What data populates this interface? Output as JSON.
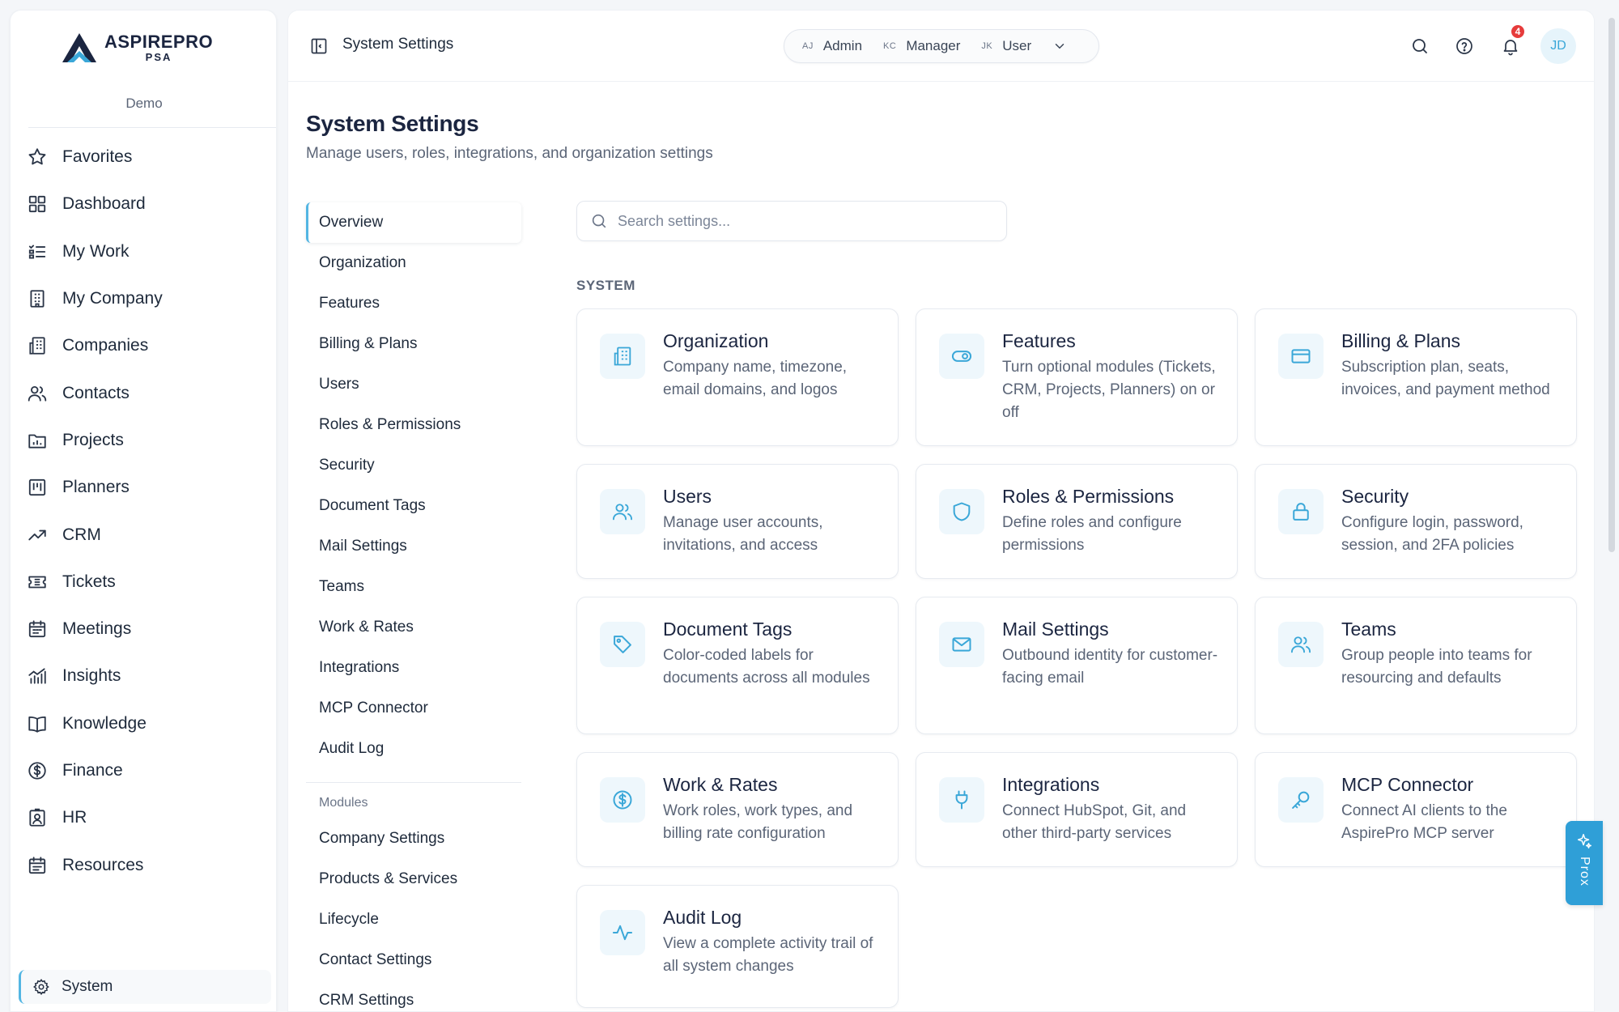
{
  "brand": {
    "name": "ASPIREPRO",
    "sub": "PSA",
    "tenant": "Demo"
  },
  "sidebar": {
    "items": [
      {
        "label": "Favorites",
        "icon": "star-icon"
      },
      {
        "label": "Dashboard",
        "icon": "grid-icon"
      },
      {
        "label": "My Work",
        "icon": "checklist-icon"
      },
      {
        "label": "My Company",
        "icon": "building-icon"
      },
      {
        "label": "Companies",
        "icon": "buildings-icon"
      },
      {
        "label": "Contacts",
        "icon": "users-icon"
      },
      {
        "label": "Projects",
        "icon": "folder-chart-icon"
      },
      {
        "label": "Planners",
        "icon": "kanban-icon"
      },
      {
        "label": "CRM",
        "icon": "trend-icon"
      },
      {
        "label": "Tickets",
        "icon": "ticket-icon"
      },
      {
        "label": "Meetings",
        "icon": "calendar-icon"
      },
      {
        "label": "Insights",
        "icon": "bar-chart-icon"
      },
      {
        "label": "Knowledge",
        "icon": "book-icon"
      },
      {
        "label": "Finance",
        "icon": "dollar-circle-icon"
      },
      {
        "label": "HR",
        "icon": "badge-icon"
      },
      {
        "label": "Resources",
        "icon": "calendar-list-icon"
      }
    ],
    "system_label": "System"
  },
  "topbar": {
    "breadcrumb": "System Settings",
    "roles": [
      {
        "initials": "AJ",
        "label": "Admin"
      },
      {
        "initials": "KC",
        "label": "Manager"
      },
      {
        "initials": "JK",
        "label": "User"
      }
    ],
    "notification_count": "4",
    "avatar_initials": "JD"
  },
  "page": {
    "title": "System Settings",
    "subtitle": "Manage users, roles, integrations, and organization settings"
  },
  "settings_nav": {
    "items": [
      "Overview",
      "Organization",
      "Features",
      "Billing & Plans",
      "Users",
      "Roles & Permissions",
      "Security",
      "Document Tags",
      "Mail Settings",
      "Teams",
      "Work & Rates",
      "Integrations",
      "MCP Connector",
      "Audit Log"
    ],
    "group_label": "Modules",
    "module_items": [
      "Company Settings",
      "Products & Services",
      "Lifecycle",
      "Contact Settings",
      "CRM Settings"
    ]
  },
  "search": {
    "placeholder": "Search settings..."
  },
  "section_label": "SYSTEM",
  "cards": [
    {
      "title": "Organization",
      "desc": "Company name, timezone, email domains, and logos",
      "icon": "building-icon"
    },
    {
      "title": "Features",
      "desc": "Turn optional modules (Tickets, CRM, Projects, Planners) on or off",
      "icon": "toggle-icon"
    },
    {
      "title": "Billing & Plans",
      "desc": "Subscription plan, seats, invoices, and payment method",
      "icon": "credit-card-icon"
    },
    {
      "title": "Users",
      "desc": "Manage user accounts, invitations, and access",
      "icon": "users-icon"
    },
    {
      "title": "Roles & Permissions",
      "desc": "Define roles and configure permissions",
      "icon": "shield-icon"
    },
    {
      "title": "Security",
      "desc": "Configure login, password, session, and 2FA policies",
      "icon": "lock-icon"
    },
    {
      "title": "Document Tags",
      "desc": "Color-coded labels for documents across all modules",
      "icon": "tag-icon"
    },
    {
      "title": "Mail Settings",
      "desc": "Outbound identity for customer-facing email",
      "icon": "mail-icon"
    },
    {
      "title": "Teams",
      "desc": "Group people into teams for resourcing and defaults",
      "icon": "team-icon"
    },
    {
      "title": "Work & Rates",
      "desc": "Work roles, work types, and billing rate configuration",
      "icon": "dollar-circle-icon"
    },
    {
      "title": "Integrations",
      "desc": "Connect HubSpot, Git, and other third-party services",
      "icon": "plug-icon"
    },
    {
      "title": "MCP Connector",
      "desc": "Connect AI clients to the AspirePro MCP server",
      "icon": "key-icon"
    },
    {
      "title": "Audit Log",
      "desc": "View a complete activity trail of all system changes",
      "icon": "activity-icon"
    }
  ],
  "prox": {
    "label": "Prox"
  },
  "colors": {
    "accent": "#53b6e3",
    "icon_bg": "#eef7fc",
    "icon_fg": "#3aa7d8",
    "badge": "#e63b3b",
    "prox_bg": "#2f9fd7"
  }
}
